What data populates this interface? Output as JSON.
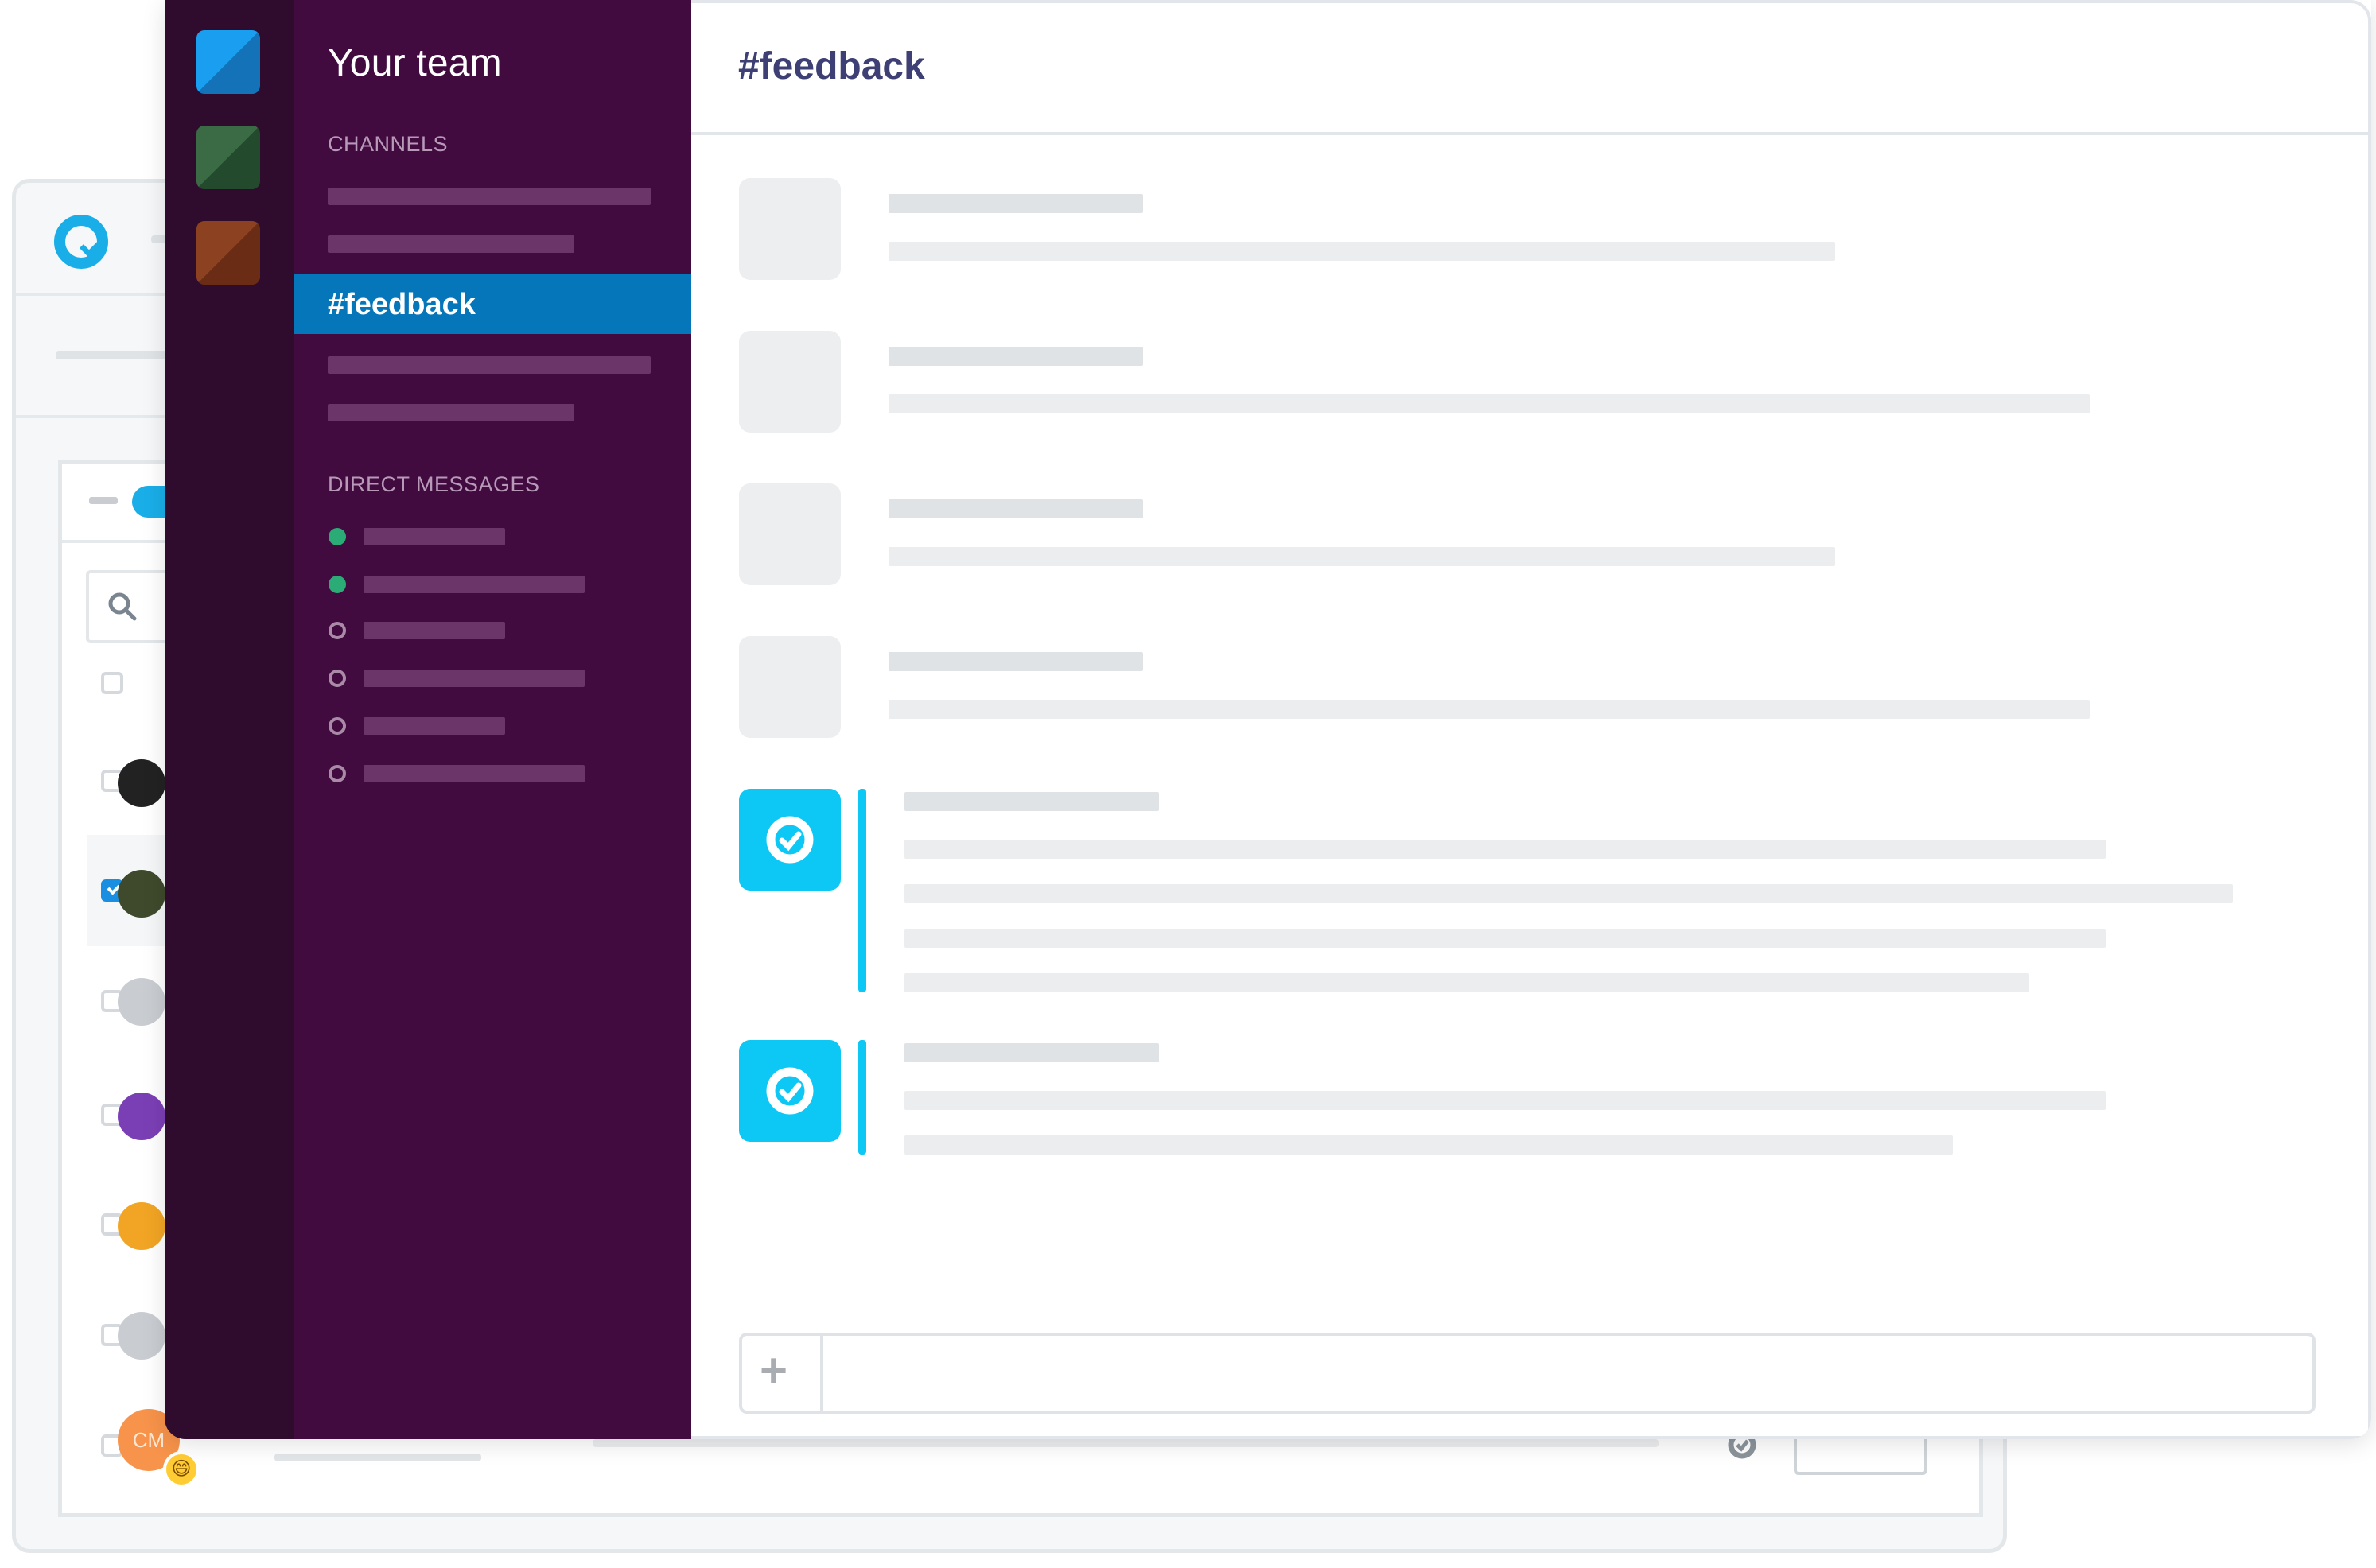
{
  "background_app": {
    "logo_icon": "checkcircle-logo-icon",
    "last_row": {
      "avatar_initials": "CM",
      "emoji": "😄"
    },
    "accent_color": "#1aaee8"
  },
  "chat": {
    "team_name": "Your team",
    "teams": [
      {
        "name": "team-blue",
        "color": "#1a8ee0"
      },
      {
        "name": "team-green",
        "color": "#2f5f3a"
      },
      {
        "name": "team-orange",
        "color": "#8a3d18"
      }
    ],
    "sections": {
      "channels": "CHANNELS",
      "direct_messages": "DIRECT MESSAGES"
    },
    "active_channel": "#feedback",
    "header_title": "#feedback",
    "direct_messages": [
      {
        "status": "online"
      },
      {
        "status": "online"
      },
      {
        "status": "offline"
      },
      {
        "status": "offline"
      },
      {
        "status": "offline"
      },
      {
        "status": "offline"
      }
    ],
    "composer": {
      "plus_label": "+",
      "placeholder": ""
    },
    "colors": {
      "sidebar": "#410b40",
      "rail": "#2f0b2e",
      "active": "#0576b9",
      "bot": "#0dc8f5"
    }
  }
}
